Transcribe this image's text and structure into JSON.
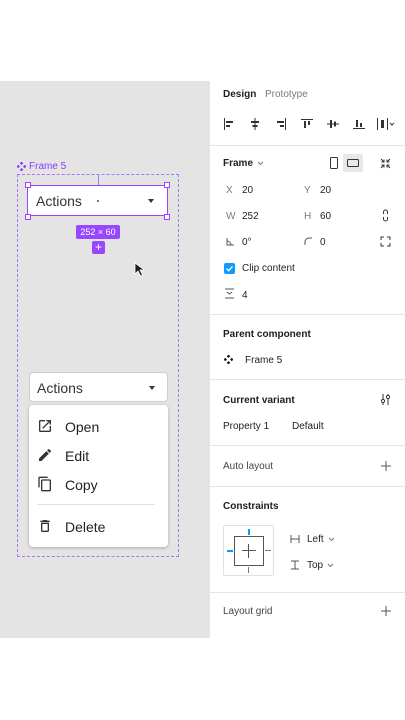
{
  "canvas": {
    "frame_label": "Frame 5",
    "selected_button_label": "Actions",
    "dimension_badge": "252 × 60",
    "plus_glyph": "+",
    "actions_button_label": "Actions",
    "menu": {
      "items": [
        {
          "label": "Open",
          "icon": "open-in-new-icon"
        },
        {
          "label": "Edit",
          "icon": "pencil-icon"
        },
        {
          "label": "Copy",
          "icon": "copy-icon"
        },
        {
          "label": "Delete",
          "icon": "trash-icon"
        }
      ]
    }
  },
  "panel": {
    "tabs": {
      "design": "Design",
      "prototype": "Prototype"
    },
    "frame": {
      "title": "Frame",
      "x_label": "X",
      "x_value": "20",
      "y_label": "Y",
      "y_value": "20",
      "w_label": "W",
      "w_value": "252",
      "h_label": "H",
      "h_value": "60",
      "rotation_value": "0°",
      "radius_value": "0",
      "clip_content_label": "Clip content",
      "clip_content_checked": true,
      "spacing_value": "4"
    },
    "parent_component": {
      "title": "Parent component",
      "name": "Frame 5"
    },
    "current_variant": {
      "title": "Current variant",
      "property": "Property 1",
      "value": "Default"
    },
    "auto_layout": {
      "title": "Auto layout"
    },
    "constraints": {
      "title": "Constraints",
      "horizontal": "Left",
      "vertical": "Top"
    },
    "layout_grid": {
      "title": "Layout grid"
    },
    "colors": {
      "accent": "#9747ff",
      "checkbox": "#0d99ff"
    }
  }
}
